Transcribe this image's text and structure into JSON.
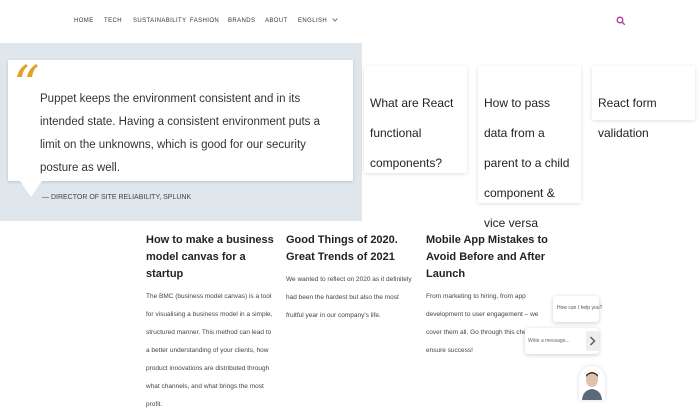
{
  "nav": {
    "items": [
      "HOME",
      "TECH",
      "SUSTAINABILITY",
      "FASHION",
      "BRANDS",
      "ABOUT",
      "ENGLISH"
    ]
  },
  "quote": {
    "text": "Puppet keeps the environment consistent and in its intended state. Having a consistent environment puts a limit on the unknowns, which is good for our security posture as well.",
    "author": "— DIRECTOR OF SITE RELIABILITY, SPLUNK"
  },
  "related": [
    {
      "title": "What are React functional components?"
    },
    {
      "title": "How to pass data from a parent to a child component & vice versa"
    },
    {
      "title": "React form validation"
    }
  ],
  "articles": [
    {
      "title": "How to make a business model canvas for a startup",
      "excerpt": "The BMC (business model canvas) is a tool for visualising a business model in a simple, structured manner. This method can lead to a better understanding of your clients, how product innovations are distributed through what channels, and what brings the most profit."
    },
    {
      "title": "Good Things of 2020. Great Trends of 2021",
      "excerpt": "We wanted to reflect on 2020 as it definitely had been the hardest but also the most fruitful year in our company's life."
    },
    {
      "title": "Mobile App Mistakes to Avoid Before and After Launch",
      "excerpt": "From marketing to hiring, from app development to user engagement – we cover them all. Go through this checklist to ensure success!"
    }
  ],
  "chat": {
    "greeting": "How can I help you?",
    "placeholder": "Write a message..."
  },
  "colors": {
    "accent": "#e3a127",
    "search": "#b0369c",
    "band": "#dfe6ec"
  }
}
